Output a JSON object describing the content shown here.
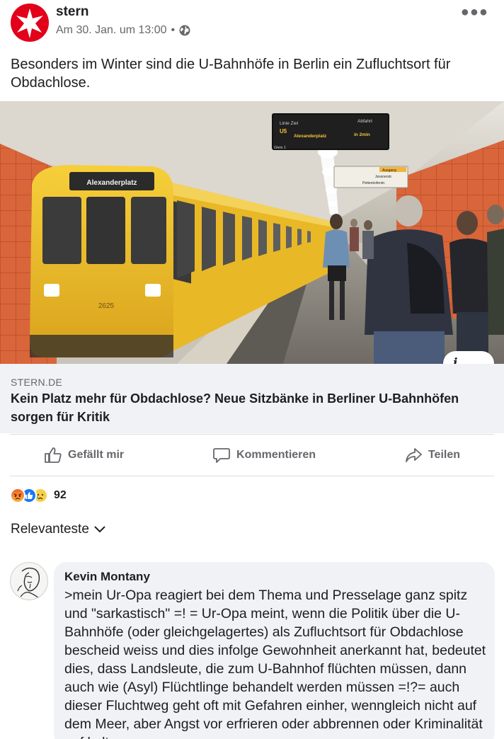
{
  "post": {
    "page_name": "stern",
    "timestamp": "Am 30. Jan. um 13:00",
    "meta_separator": "•",
    "privacy_icon": "globe-icon",
    "more_icon": "more-options-icon",
    "text": "Besonders im Winter sind die U-Bahnhöfe in Berlin ein Zufluchtsort für Obdachlose."
  },
  "image": {
    "sign_line_label": "Linie Ziel",
    "sign_line": "U5",
    "sign_destination": "Alexanderplatz",
    "sign_departure_label": "Abfahrt",
    "sign_departure": "in 2min",
    "sign_platform": "Gleis 1",
    "train_destination": "Alexanderplatz",
    "train_number": "2625",
    "exit_sign": "Ausgang",
    "exit_street_1": "Jessnerstr.",
    "exit_street_2": "Pettenkoferstr.",
    "info_label": "i"
  },
  "link": {
    "domain": "STERN.DE",
    "title": "Kein Platz mehr für Obdachlose? Neue Sitzbänke in Berliner U-Bahnhöfen sorgen für Kritik"
  },
  "actions": {
    "like": "Gefällt mir",
    "comment": "Kommentieren",
    "share": "Teilen"
  },
  "reactions": {
    "icons": [
      "angry-reaction-icon",
      "like-reaction-icon",
      "sad-reaction-icon"
    ],
    "count": "92"
  },
  "comments": {
    "sort_label": "Relevanteste",
    "items": [
      {
        "author": "Kevin Montany",
        "text": ">mein Ur-Opa reagiert bei dem Thema und Presselage ganz spitz und \"sarkastisch\" =! = Ur-Opa meint, wenn die Politik über die U-Bahnhöfe (oder gleichgelagertes) als Zufluchtsort für Obdachlose bescheid weiss und dies infolge Gewohnheit anerkannt hat, bedeutet dies, dass Landsleute, die zum U-Bahnhof flüchten müssen, dann auch wie (Asyl) Flüchtlinge behandelt werden müssen =!?= auch dieser Fluchtweg geht oft mit Gefahren einher, wenngleich nicht auf dem Meer, aber Angst vor erfrieren oder abbrennen oder Kriminalität auf kalte"
      }
    ]
  },
  "colors": {
    "stern_red": "#e2001a",
    "train_yellow": "#f2c12e",
    "tile_orange": "#d9653a",
    "like_blue": "#1877f2",
    "secondary_text": "#65676b"
  }
}
